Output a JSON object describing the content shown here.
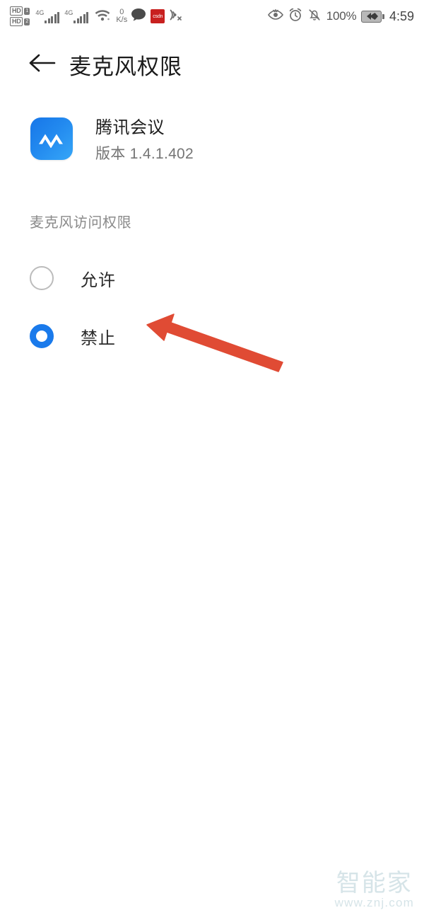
{
  "status_bar": {
    "hd_badge_1": "HD",
    "sim_badge_1": "1",
    "hd_badge_2": "HD",
    "sim_badge_2": "2",
    "network_gen_1": "4G",
    "network_gen_2": "4G",
    "speed_value": "0",
    "speed_unit": "K/s",
    "csdn_logo_text": "csdn",
    "battery_percent": "100%",
    "time": "4:59",
    "icons": [
      "hd-call-icon",
      "sim1-icon",
      "hd-call-icon",
      "sim2-icon",
      "signal-bars-icon",
      "signal-bars-icon",
      "wifi-icon",
      "network-speed-icon",
      "message-bubble-icon",
      "csdn-app-icon",
      "nfc-off-icon",
      "eye-comfort-icon",
      "alarm-clock-icon",
      "bell-muted-icon",
      "battery-charging-icon"
    ]
  },
  "app_bar": {
    "back_icon": "back-arrow-icon",
    "title": "麦克风权限"
  },
  "app_info": {
    "icon_name": "tencent-meeting-app-icon",
    "name": "腾讯会议",
    "version": "版本 1.4.1.402"
  },
  "permission": {
    "section_label": "麦克风访问权限",
    "options": [
      {
        "label": "允许",
        "selected": false
      },
      {
        "label": "禁止",
        "selected": true
      }
    ]
  },
  "annotation": {
    "type": "red-arrow",
    "color": "#E04B34",
    "points_to": "禁止"
  },
  "watermark": {
    "brand": "智能家",
    "url": "www.znj.com",
    "color": "#cfe0e4"
  },
  "colors": {
    "accent_blue": "#1a7aeb",
    "app_icon_blue": "#2289ef",
    "annotation_red": "#E04B34",
    "text_primary": "#1a1a1a",
    "text_secondary": "#757575",
    "background": "#ffffff"
  }
}
